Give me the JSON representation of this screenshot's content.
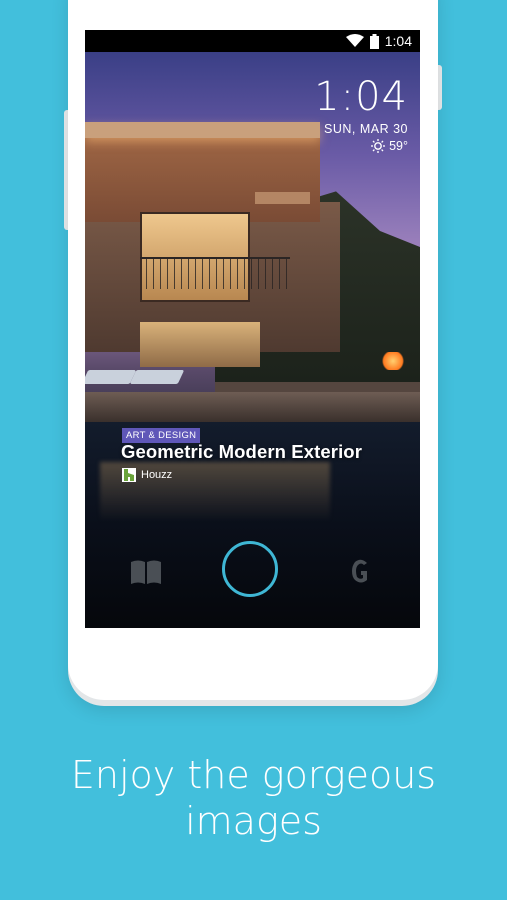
{
  "status_bar": {
    "time": "1:04"
  },
  "lock_screen": {
    "time": "1:04",
    "date": "SUN, MAR 30",
    "temperature": "59°"
  },
  "article": {
    "category": "ART & DESIGN",
    "title": "Geometric Modern Exterior",
    "source": "Houzz"
  },
  "icons": {
    "wifi": "wifi-icon",
    "battery": "battery-icon",
    "weather": "sun-icon",
    "left_action": "book-icon",
    "center_action": "unlock-ring",
    "right_action": "g-icon"
  },
  "colors": {
    "background": "#42bfdc",
    "ring": "#3fb7d5",
    "badge": "#5f57b8"
  },
  "caption": {
    "line1": "Enjoy the gorgeous",
    "line2": "images"
  }
}
